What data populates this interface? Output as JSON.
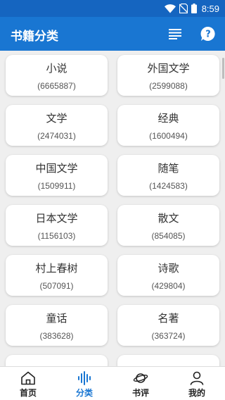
{
  "status_bar": {
    "time": "8:59"
  },
  "app_bar": {
    "title": "书籍分类",
    "list_icon": "list-icon",
    "help_icon": "help-icon"
  },
  "categories": [
    {
      "name": "小说",
      "count": "(6665887)"
    },
    {
      "name": "外国文学",
      "count": "(2599088)"
    },
    {
      "name": "文学",
      "count": "(2474031)"
    },
    {
      "name": "经典",
      "count": "(1600494)"
    },
    {
      "name": "中国文学",
      "count": "(1509911)"
    },
    {
      "name": "随笔",
      "count": "(1424583)"
    },
    {
      "name": "日本文学",
      "count": "(1156103)"
    },
    {
      "name": "散文",
      "count": "(854085)"
    },
    {
      "name": "村上春树",
      "count": "(507091)"
    },
    {
      "name": "诗歌",
      "count": "(429804)"
    },
    {
      "name": "童话",
      "count": "(383628)"
    },
    {
      "name": "名著",
      "count": "(363724)"
    },
    {
      "name": "",
      "count": ""
    },
    {
      "name": "",
      "count": ""
    }
  ],
  "bottom_nav": [
    {
      "label": "首页",
      "icon": "home-icon",
      "active": false
    },
    {
      "label": "分类",
      "icon": "audio-wave-icon",
      "active": true
    },
    {
      "label": "书评",
      "icon": "planet-icon",
      "active": false
    },
    {
      "label": "我的",
      "icon": "user-icon",
      "active": false
    }
  ],
  "colors": {
    "primary": "#1976d2",
    "status_bar": "#1565c0",
    "background": "#efefef"
  }
}
